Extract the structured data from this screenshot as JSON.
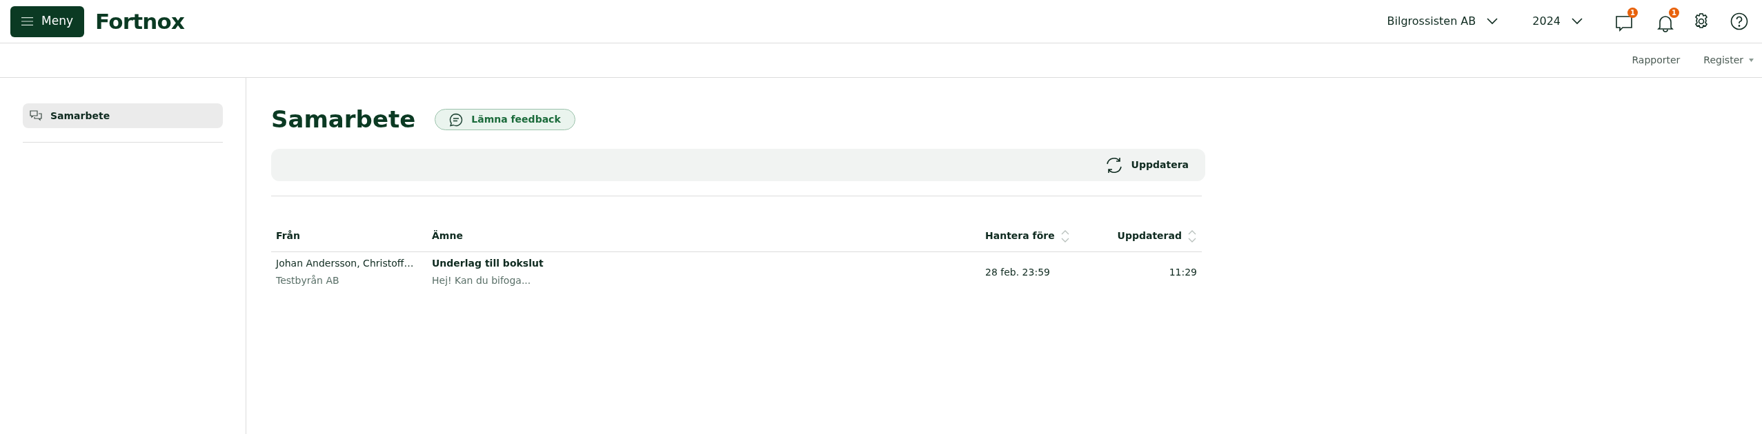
{
  "header": {
    "menu_button": "Meny",
    "logo": "Fortnox",
    "company": "Bilgrossisten AB",
    "year": "2024",
    "messages_badge": "1",
    "notifications_badge": "1"
  },
  "subnav": [
    "Rapporter",
    "Register"
  ],
  "sidebar": {
    "items": [
      {
        "label": "Samarbete",
        "selected": true
      }
    ]
  },
  "page": {
    "title": "Samarbete",
    "feedback_button": "Lämna feedback",
    "refresh_button": "Uppdatera"
  },
  "table": {
    "columns": [
      {
        "label": "Från",
        "sortable": false
      },
      {
        "label": "Ämne",
        "sortable": false
      },
      {
        "label": "Hantera före",
        "sortable": true
      },
      {
        "label": "Uppdaterad",
        "sortable": true
      }
    ],
    "rows": [
      {
        "from": "Johan Andersson, Christoff…",
        "from_company": "Testbyrån AB",
        "subject": "Underlag till bokslut",
        "preview": "Hej! Kan du bifoga...",
        "due": "28 feb. 23:59",
        "updated": "11:29"
      }
    ]
  }
}
